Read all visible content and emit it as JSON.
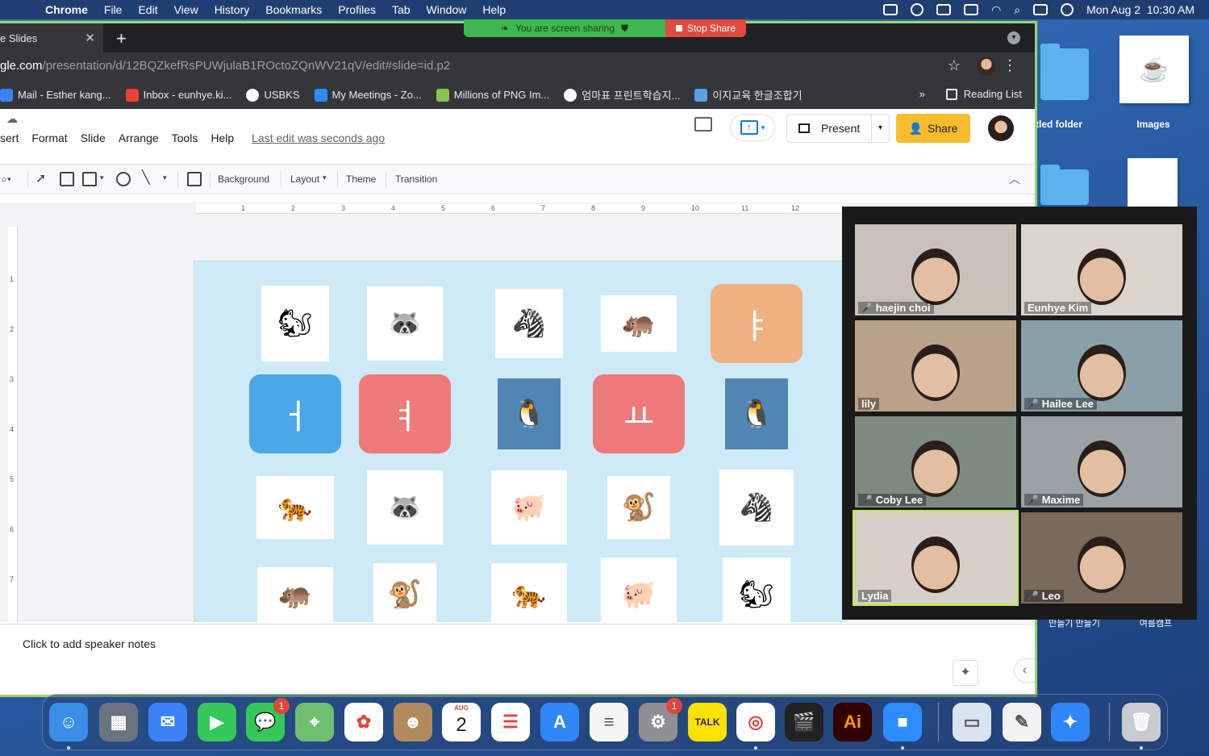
{
  "menubar": {
    "app_name": "Chrome",
    "items": [
      "File",
      "Edit",
      "View",
      "History",
      "Bookmarks",
      "Profiles",
      "Tab",
      "Window",
      "Help"
    ],
    "datetime": "Mon Aug 2  10:30 AM"
  },
  "share_banner": {
    "status_text": "You are screen sharing",
    "stop_label": "Stop Share"
  },
  "browser": {
    "tab_title": "e Slides",
    "url_host": "gle.com",
    "url_path": "/presentation/d/12BQZkefRsPUWjulaB1ROctoZQnWV21qV/edit#slide=id.p2",
    "bookmarks": [
      {
        "label": "Mail - Esther kang...",
        "color": "#3b82f6"
      },
      {
        "label": "Inbox - eunhye.ki...",
        "color": "#e94335"
      },
      {
        "label": "USBKS",
        "color": "#ffffff"
      },
      {
        "label": "My Meetings - Zo...",
        "color": "#2d8cff"
      },
      {
        "label": "Millions of PNG Im...",
        "color": "#8bc34a"
      },
      {
        "label": "엄마표 프린트학습지...",
        "color": "#ffffff"
      },
      {
        "label": "이지교육 한글조합기",
        "color": "#5aa0e6"
      }
    ],
    "bookmarks_more": "»",
    "reading_list": "Reading List"
  },
  "slides": {
    "menu": [
      "sert",
      "Format",
      "Slide",
      "Arrange",
      "Tools",
      "Help"
    ],
    "last_edit": "Last edit was seconds ago",
    "present_label": "Present",
    "share_label": "Share",
    "toolbar": {
      "background": "Background",
      "layout": "Layout",
      "theme": "Theme",
      "transition": "Transition"
    },
    "ruler_top": [
      "1",
      "2",
      "3",
      "4",
      "5",
      "6",
      "7",
      "8",
      "9",
      "10",
      "11",
      "12"
    ],
    "ruler_left": [
      "1",
      "2",
      "3",
      "4",
      "5",
      "6",
      "7"
    ],
    "notes_placeholder": "Click to add speaker notes",
    "cards": [
      {
        "kind": "animal",
        "name": "squirrel",
        "glyph": "🐿"
      },
      {
        "kind": "animal",
        "name": "raccoon",
        "glyph": "🦝"
      },
      {
        "kind": "animal",
        "name": "zebra",
        "glyph": "🦓"
      },
      {
        "kind": "animal",
        "name": "hippo",
        "glyph": "🦛"
      },
      {
        "kind": "letter",
        "name": "letter-ya",
        "glyph": "ㅑ",
        "color": "#f0b080"
      },
      {
        "kind": "letter",
        "name": "letter-eo",
        "glyph": "ㅓ",
        "color": "#4aa8e8"
      },
      {
        "kind": "letter",
        "name": "letter-yeo",
        "glyph": "ㅕ",
        "color": "#ee7a7a"
      },
      {
        "kind": "animal",
        "name": "penguin",
        "glyph": "🐧"
      },
      {
        "kind": "letter",
        "name": "letter-yo",
        "glyph": "ㅛ",
        "color": "#ee7a7a"
      },
      {
        "kind": "animal",
        "name": "penguin",
        "glyph": "🐧"
      },
      {
        "kind": "animal",
        "name": "tiger",
        "glyph": "🐅"
      },
      {
        "kind": "animal",
        "name": "raccoon",
        "glyph": "🦝"
      },
      {
        "kind": "animal",
        "name": "pig",
        "glyph": "🐖"
      },
      {
        "kind": "animal",
        "name": "monkey",
        "glyph": "🐒"
      },
      {
        "kind": "animal",
        "name": "zebra",
        "glyph": "🦓"
      },
      {
        "kind": "animal",
        "name": "hippo",
        "glyph": "🦛"
      },
      {
        "kind": "animal",
        "name": "monkey",
        "glyph": "🐒"
      },
      {
        "kind": "animal",
        "name": "tiger",
        "glyph": "🐅"
      },
      {
        "kind": "animal",
        "name": "pig",
        "glyph": "🐖"
      },
      {
        "kind": "animal",
        "name": "squirrel",
        "glyph": "🐿"
      }
    ]
  },
  "desktop": {
    "icons": [
      {
        "label": "tled folder"
      },
      {
        "label": "Images"
      }
    ],
    "hidden_labels": [
      "만들기 만들기",
      "여름캠프"
    ]
  },
  "zoom": {
    "participants": [
      {
        "name": "haejin choi",
        "muted": true,
        "active": false,
        "bg": "#c8c2b8"
      },
      {
        "name": "Eunhye Kim",
        "muted": false,
        "active": false,
        "bg": "#d9d4cc"
      },
      {
        "name": "lily",
        "muted": false,
        "active": false,
        "bg": "#b8a38a"
      },
      {
        "name": "Hailee Lee",
        "muted": true,
        "active": false,
        "bg": "#8aa0a8"
      },
      {
        "name": "Coby Lee",
        "muted": true,
        "active": false,
        "bg": "#7c8a80"
      },
      {
        "name": "Maxime",
        "muted": true,
        "active": false,
        "bg": "#9aa2a8"
      },
      {
        "name": "Lydia",
        "muted": false,
        "active": true,
        "bg": "#d8cfc8"
      },
      {
        "name": "Leo",
        "muted": true,
        "active": false,
        "bg": "#7a6a5c"
      }
    ]
  },
  "dock": {
    "apps": [
      {
        "name": "finder",
        "color": "#3a8ee6",
        "glyph": "☺"
      },
      {
        "name": "launchpad",
        "color": "#6b7280",
        "glyph": "▦"
      },
      {
        "name": "mail",
        "color": "#3b82f6",
        "glyph": "✉"
      },
      {
        "name": "facetime",
        "color": "#34c759",
        "glyph": "▶"
      },
      {
        "name": "messages",
        "color": "#34c759",
        "glyph": "💬",
        "badge": "1"
      },
      {
        "name": "maps",
        "color": "#6fbf73",
        "glyph": "⌖"
      },
      {
        "name": "photos",
        "color": "#ffffff",
        "glyph": "✿"
      },
      {
        "name": "contacts",
        "color": "#b08a5c",
        "glyph": "☻"
      },
      {
        "name": "calendar",
        "color": "#ffffff",
        "month": "AUG",
        "day": "2"
      },
      {
        "name": "reminders",
        "color": "#ffffff",
        "glyph": "☰"
      },
      {
        "name": "app-store",
        "color": "#2f86f6",
        "glyph": "A"
      },
      {
        "name": "notes",
        "color": "#f5f5f5",
        "glyph": "≡"
      },
      {
        "name": "system-preferences",
        "color": "#8e8e93",
        "glyph": "⚙",
        "badge": "1"
      },
      {
        "name": "kakaotalk",
        "color": "#fae100",
        "glyph": "TALK"
      },
      {
        "name": "chrome",
        "color": "#ffffff",
        "glyph": "◎"
      },
      {
        "name": "final-cut",
        "color": "#222222",
        "glyph": "🎬"
      },
      {
        "name": "illustrator",
        "color": "#330000",
        "glyph": "Ai"
      },
      {
        "name": "zoom",
        "color": "#2d8cff",
        "glyph": "■"
      },
      {
        "name": "preview",
        "color": "#d9e4f0",
        "glyph": "▭"
      },
      {
        "name": "textedit",
        "color": "#f2f2f2",
        "glyph": "✎"
      },
      {
        "name": "safari",
        "color": "#2f86f6",
        "glyph": "✦"
      },
      {
        "name": "trash",
        "color": "#c8ccd0",
        "glyph": "🗑"
      }
    ]
  }
}
